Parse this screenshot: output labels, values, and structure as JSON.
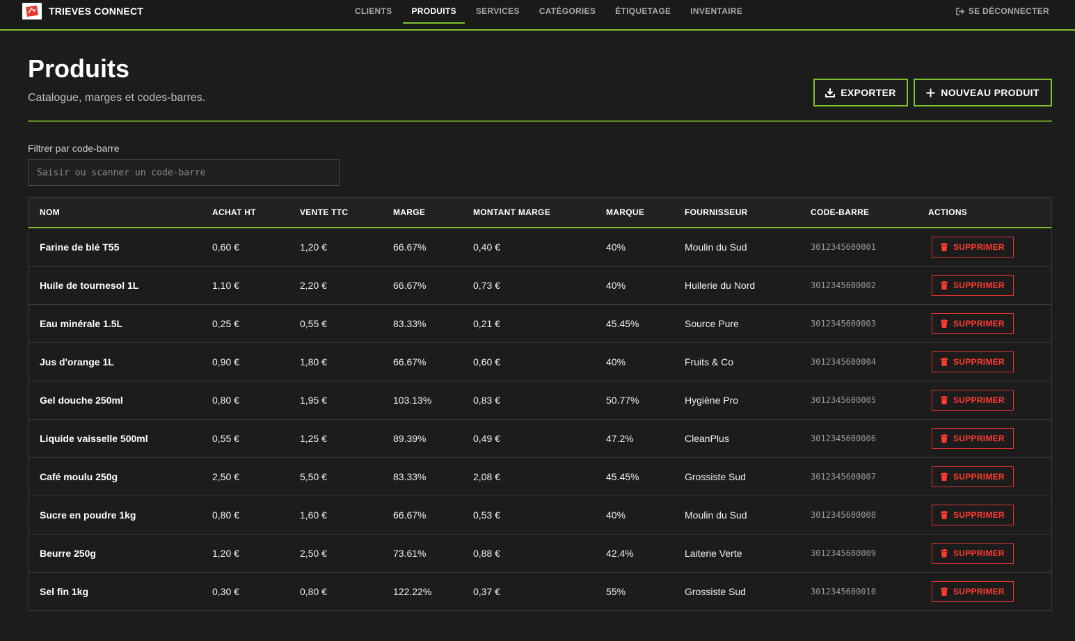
{
  "app": {
    "brand": "TRIEVES CONNECT"
  },
  "nav": {
    "items": [
      "CLIENTS",
      "PRODUITS",
      "SERVICES",
      "CATÉGORIES",
      "ÉTIQUETAGE",
      "INVENTAIRE"
    ],
    "active": "PRODUITS",
    "logout": "SE DÉCONNECTER"
  },
  "header": {
    "title": "Produits",
    "subtitle": "Catalogue, marges et codes-barres.",
    "export_label": "EXPORTER",
    "new_label": "NOUVEAU PRODUIT"
  },
  "filter": {
    "label": "Filtrer par code-barre",
    "placeholder": "Saisir ou scanner un code-barre",
    "value": ""
  },
  "table": {
    "columns": [
      "NOM",
      "ACHAT HT",
      "VENTE TTC",
      "MARGE",
      "MONTANT MARGE",
      "MARQUE",
      "FOURNISSEUR",
      "CODE-BARRE",
      "ACTIONS"
    ],
    "delete_label": "SUPPRIMER",
    "rows": [
      [
        "Farine de blé T55",
        "0,60 €",
        "1,20 €",
        "66.67%",
        "0,40 €",
        "40%",
        "Moulin du Sud",
        "3012345600001"
      ],
      [
        "Huile de tournesol 1L",
        "1,10 €",
        "2,20 €",
        "66.67%",
        "0,73 €",
        "40%",
        "Huilerie du Nord",
        "3012345600002"
      ],
      [
        "Eau minérale 1.5L",
        "0,25 €",
        "0,55 €",
        "83.33%",
        "0,21 €",
        "45.45%",
        "Source Pure",
        "3012345600003"
      ],
      [
        "Jus d'orange 1L",
        "0,90 €",
        "1,80 €",
        "66.67%",
        "0,60 €",
        "40%",
        "Fruits & Co",
        "3012345600004"
      ],
      [
        "Gel douche 250ml",
        "0,80 €",
        "1,95 €",
        "103.13%",
        "0,83 €",
        "50.77%",
        "Hygiène Pro",
        "3012345600005"
      ],
      [
        "Liquide vaisselle 500ml",
        "0,55 €",
        "1,25 €",
        "89.39%",
        "0,49 €",
        "47.2%",
        "CleanPlus",
        "3012345600006"
      ],
      [
        "Café moulu 250g",
        "2,50 €",
        "5,50 €",
        "83.33%",
        "2,08 €",
        "45.45%",
        "Grossiste Sud",
        "3012345600007"
      ],
      [
        "Sucre en poudre 1kg",
        "0,80 €",
        "1,60 €",
        "66.67%",
        "0,53 €",
        "40%",
        "Moulin du Sud",
        "3012345600008"
      ],
      [
        "Beurre 250g",
        "1,20 €",
        "2,50 €",
        "73.61%",
        "0,88 €",
        "42.4%",
        "Laiterie Verte",
        "3012345600009"
      ],
      [
        "Sel fin 1kg",
        "0,30 €",
        "0,80 €",
        "122.22%",
        "0,37 €",
        "55%",
        "Grossiste Sud",
        "3012345600010"
      ]
    ]
  },
  "colors": {
    "accent": "#7fc12e",
    "danger": "#ff3b30",
    "background": "#1c1c1c"
  }
}
